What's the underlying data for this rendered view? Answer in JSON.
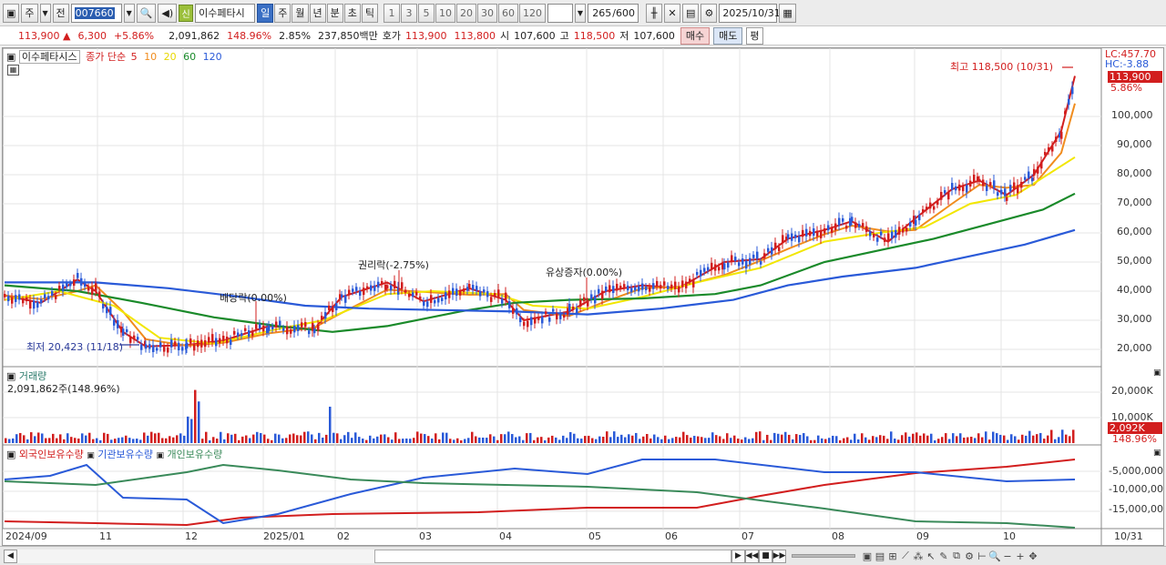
{
  "toolbar": {
    "market_type": "주",
    "view_mode": "전",
    "stock_code": "007660",
    "shin_label": "신",
    "stock_name": "이수페타시",
    "periods": [
      "일",
      "주",
      "월",
      "년",
      "분",
      "초",
      "틱"
    ],
    "selected_period": "일",
    "intervals": [
      "1",
      "3",
      "5",
      "10",
      "20",
      "30",
      "60",
      "120"
    ],
    "count_display": "265",
    "count_max": "/600",
    "date": "2025/10/31"
  },
  "quote": {
    "price": "113,900",
    "direction": "▲",
    "change": "6,300",
    "change_pct": "+5.86%",
    "volume": "2,091,862",
    "volume_ratio": "148.96%",
    "turnover": "2.85%",
    "amount": "237,850백만",
    "ask_label": "호가",
    "ask": "113,900",
    "bid": "113,800",
    "open_label": "시",
    "open": "107,600",
    "high_label": "고",
    "high": "118,500",
    "low_label": "저",
    "low": "107,600",
    "buy_label": "매수",
    "sell_label": "매도",
    "pyeong_label": "평"
  },
  "price_panel": {
    "stock_label": "이수페타시스",
    "ma_title": "종가 단순",
    "ma_periods": [
      "5",
      "10",
      "20",
      "60",
      "120"
    ],
    "ma_colors": [
      "#d21e1e",
      "#f08c1e",
      "#f2e600",
      "#1a8a2a",
      "#2a5ad8"
    ],
    "lc": "LC:457.70",
    "hc": "HC:-3.88",
    "price_tag": "113,900",
    "pct_tag": "5.86%",
    "high_note": "최고 118,500 (10/31)",
    "low_note": "최저 20,423 (11/18)",
    "events": [
      "배당락(0.00%)",
      "권리락(-2.75%)",
      "유상증자(0.00%)"
    ],
    "y_ticks": [
      "100,000",
      "90,000",
      "80,000",
      "70,000",
      "60,000",
      "50,000",
      "40,000",
      "30,000",
      "20,000"
    ]
  },
  "volume_panel": {
    "title": "거래량",
    "value": "2,091,862주(148.96%)",
    "y_ticks": [
      "20,000K",
      "10,000K"
    ],
    "tag_volume": "2,092K",
    "tag_pct": "148.96%"
  },
  "holdings_panel": {
    "series": [
      "외국인보유수량",
      "기관보유수량",
      "개인보유수량"
    ],
    "colors": [
      "#d21e1e",
      "#2a5ad8",
      "#3a8a5a"
    ],
    "y_ticks": [
      "-5,000,000",
      "-10,000,00",
      "-15,000,00"
    ]
  },
  "x_axis": {
    "labels": [
      "2024/09",
      "11",
      "12",
      "2025/01",
      "02",
      "03",
      "04",
      "05",
      "06",
      "07",
      "08",
      "09",
      "10"
    ],
    "current": "10/31"
  },
  "icons": [
    "search-icon",
    "sound-icon",
    "chart-type-icon",
    "crosshair-icon",
    "save-icon",
    "gear-icon",
    "calendar-icon"
  ]
}
